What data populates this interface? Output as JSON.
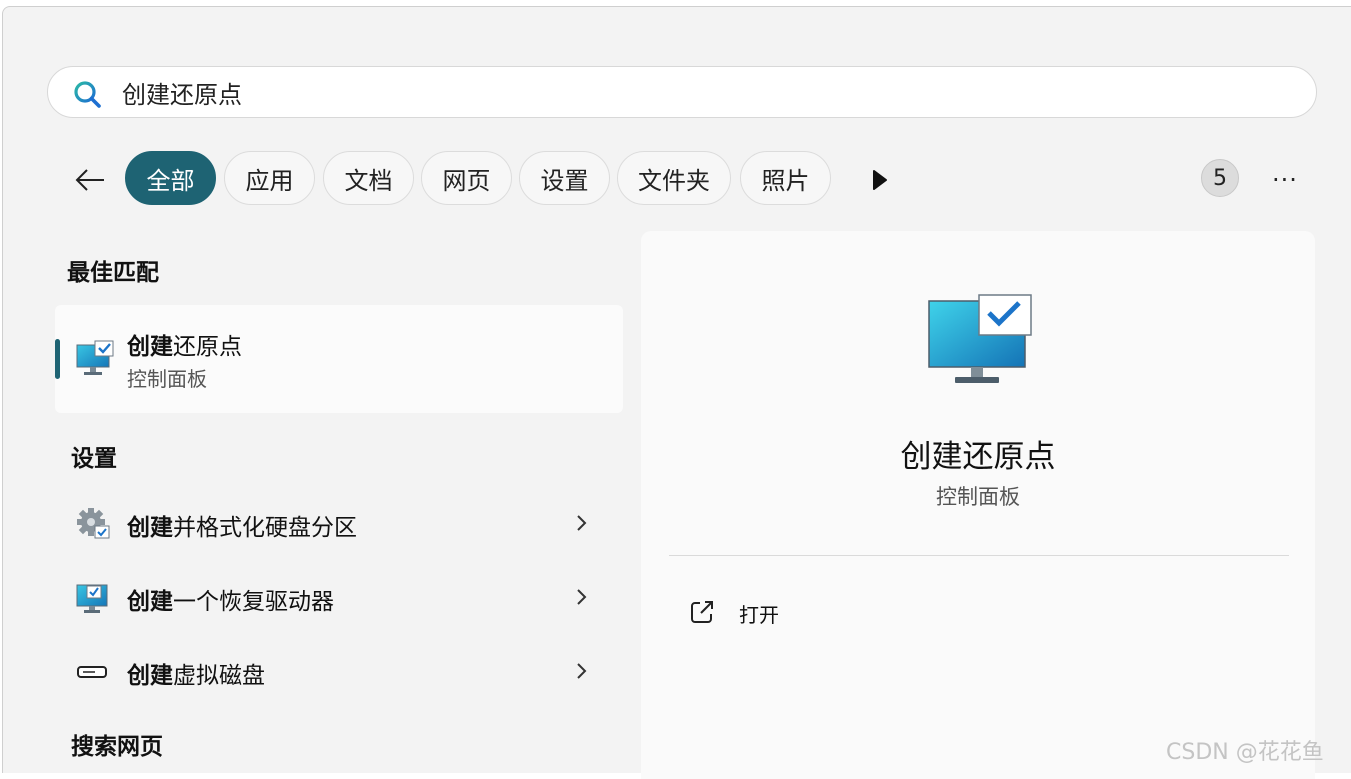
{
  "search": {
    "value": "创建还原点"
  },
  "filters": {
    "tabs": [
      {
        "label": "全部",
        "active": true
      },
      {
        "label": "应用",
        "active": false
      },
      {
        "label": "文档",
        "active": false
      },
      {
        "label": "网页",
        "active": false
      },
      {
        "label": "设置",
        "active": false
      },
      {
        "label": "文件夹",
        "active": false
      },
      {
        "label": "照片",
        "active": false
      }
    ],
    "count": "5",
    "more": "···"
  },
  "best_match": {
    "heading": "最佳匹配",
    "title_bold": "创建",
    "title_rest": "还原点",
    "subtitle": "控制面板"
  },
  "settings": {
    "heading": "设置",
    "items": [
      {
        "bold": "创建",
        "rest": "并格式化硬盘分区",
        "icon": "gear-check-icon"
      },
      {
        "bold": "创建",
        "rest": "一个恢复驱动器",
        "icon": "monitor-check-icon"
      },
      {
        "bold": "创建",
        "rest": "虚拟磁盘",
        "icon": "disk-drive-icon"
      }
    ]
  },
  "web_search": {
    "heading": "搜索网页"
  },
  "detail": {
    "title": "创建还原点",
    "subtitle": "控制面板",
    "action_open": "打开"
  },
  "watermark": "CSDN @花花鱼",
  "colors": {
    "accent": "#1e6373",
    "background": "#f3f3f3",
    "pane": "#fafafa"
  }
}
